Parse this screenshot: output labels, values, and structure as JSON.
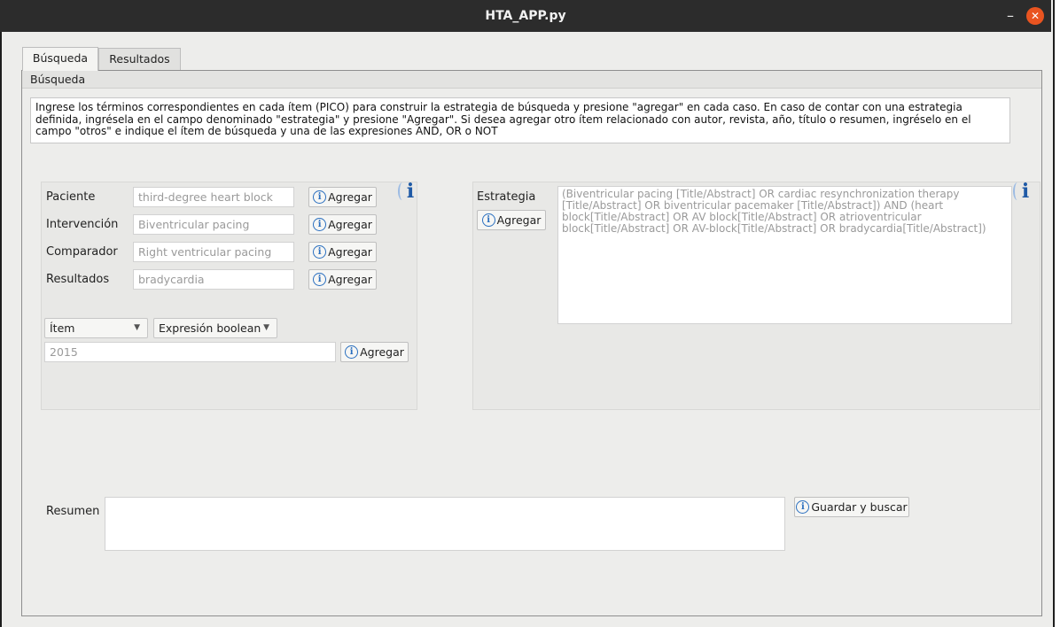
{
  "window": {
    "title": "HTA_APP.py",
    "minimize_glyph": "–",
    "close_glyph": "✕"
  },
  "tabs": [
    {
      "label": "Búsqueda"
    },
    {
      "label": "Resultados"
    }
  ],
  "group": {
    "title": "Búsqueda"
  },
  "instructions": "Ingrese los términos correspondientes en cada ítem (PICO) para construir la estrategia de búsqueda y presione \"agregar\" en cada caso. En caso de contar con una estrategia definida, ingrésela en el campo denominado \"estrategia\" y presione \"Agregar\". Si desea agregar otro ítem relacionado con autor, revista, año, título o resumen, ingréselo en el campo \"otros\" e indique el ítem de búsqueda y una de las expresiones AND, OR o NOT",
  "pico": {
    "rows": [
      {
        "label": "Paciente",
        "value": "third-degree heart block",
        "button": "Agregar"
      },
      {
        "label": "Intervención",
        "value": "Biventricular pacing",
        "button": "Agregar"
      },
      {
        "label": "Comparador",
        "value": "Right ventricular pacing",
        "button": "Agregar"
      },
      {
        "label": "Resultados",
        "value": "bradycardia",
        "button": "Agregar"
      }
    ],
    "info_glyph": "i"
  },
  "other": {
    "item_select": "Ítem",
    "boolean_select": "Expresión boolean",
    "value": "2015",
    "button": "Agregar"
  },
  "strategy": {
    "label": "Estrategia",
    "button": "Agregar",
    "text": "(Biventricular pacing [Title/Abstract] OR cardiac resynchronization therapy [Title/Abstract] OR biventricular pacemaker [Title/Abstract]) AND (heart block[Title/Abstract] OR AV block[Title/Abstract] OR atrioventricular block[Title/Abstract] OR AV-block[Title/Abstract] OR bradycardia[Title/Abstract])",
    "info_glyph": "i"
  },
  "summary": {
    "label": "Resumen",
    "value": "",
    "button": "Guardar y buscar"
  },
  "icons": {
    "small_info": "i",
    "colors": {
      "info_blue": "#2a6fbf",
      "close_orange": "#e95420"
    }
  }
}
